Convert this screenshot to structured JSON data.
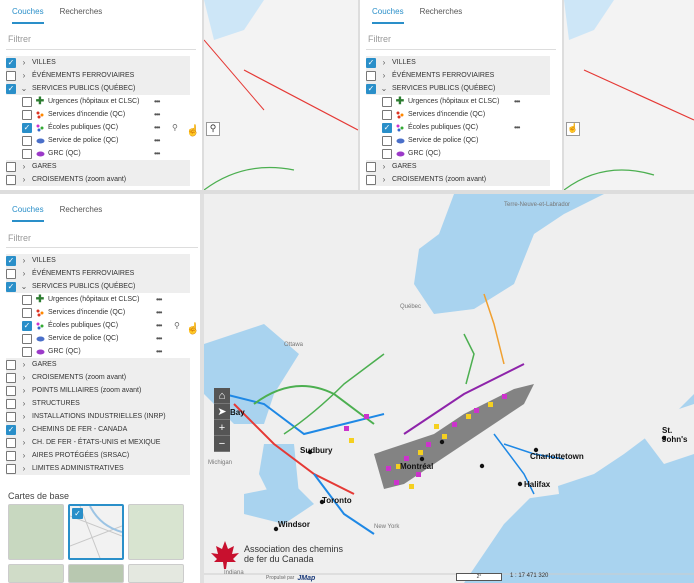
{
  "tabs": {
    "layers": "Couches",
    "search": "Recherches"
  },
  "filter_placeholder": "Filtrer",
  "layers": {
    "villes": "VILLES",
    "evenements": "ÉVÉNEMENTS FERROVIAIRES",
    "services_publics": "SERVICES PUBLICS (QUÉBEC)",
    "urgences": "Urgences (hôpitaux et CLSC)",
    "incendie": "Services d'incendie (QC)",
    "ecoles": "Écoles publiques (QC)",
    "police": "Service de police (QC)",
    "grc": "GRC (QC)",
    "gares": "GARES",
    "croisements": "CROISEMENTS (zoom avant)",
    "points_milliaires": "POINTS MILLIAIRES (zoom avant)",
    "structures": "STRUCTURES",
    "installations": "INSTALLATIONS INDUSTRIELLES (INRP)",
    "chemins_fer": "CHEMINS DE FER - CANADA",
    "ch_fer_us": "CH. DE FER - ÉTATS-UNIS et MEXIQUE",
    "aires": "AIRES PROTÉGÉES (SRSAC)",
    "limites": "LIMITES ADMINISTRATIVES"
  },
  "more_glyph": "•••",
  "basemaps_title": "Cartes de base",
  "map_labels": {
    "ottawa": "Ottawa",
    "quebec": "Québec",
    "montreal": "Montréal",
    "toronto": "Toronto",
    "windsor": "Windsor",
    "sudbury": "Sudbury",
    "halifax": "Halifax",
    "charlottetown": "Charlottetown",
    "st_johns": "St. John's",
    "bay": "Bay",
    "labrador": "Terre-Neuve-et-Labrador",
    "michigan": "Michigan",
    "new_york": "New York",
    "indiana": "Indiana"
  },
  "brand": {
    "line1": "Association des chemins",
    "line2": "de fer du Canada",
    "powered": "Propulsé par",
    "jmap": "JMap"
  },
  "scale": {
    "bar": "2°",
    "ratio": "1 : 17 471 320"
  },
  "colors": {
    "accent": "#2a8fc9",
    "water": "#a9d3ef",
    "land": "#efefef",
    "brand_red": "#c8102e"
  },
  "icons": {
    "home": "home-icon",
    "locate": "locate-icon",
    "zoom_in": "zoom-in-icon",
    "zoom_out": "zoom-out-icon",
    "cursor": "hand-cursor-icon"
  }
}
